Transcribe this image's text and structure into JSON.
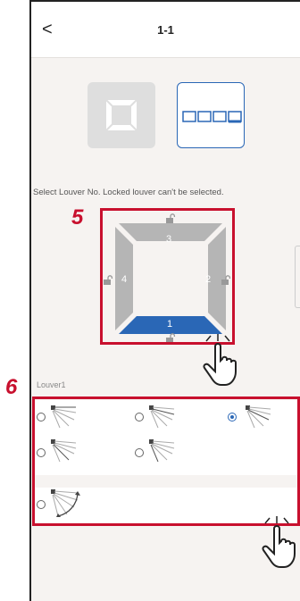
{
  "header": {
    "back_label": "<",
    "title": "1-1"
  },
  "select_text": "Select Louver No. Locked louver can't be selected.",
  "louvers": {
    "top": "3",
    "left": "4",
    "right": "2",
    "bottom": "1"
  },
  "markers": {
    "five": "5",
    "six": "6"
  },
  "section_label": "Louver1",
  "colors": {
    "accent": "#2a67b6",
    "highlight": "#c8102e",
    "louver_gray": "#b5b5b5"
  },
  "icons": [
    "back-icon",
    "louver-square-icon",
    "louver-segments-icon",
    "unlock-icon",
    "hand-pointer-icon",
    "airflow-angle-icon",
    "swing-fan-icon"
  ]
}
